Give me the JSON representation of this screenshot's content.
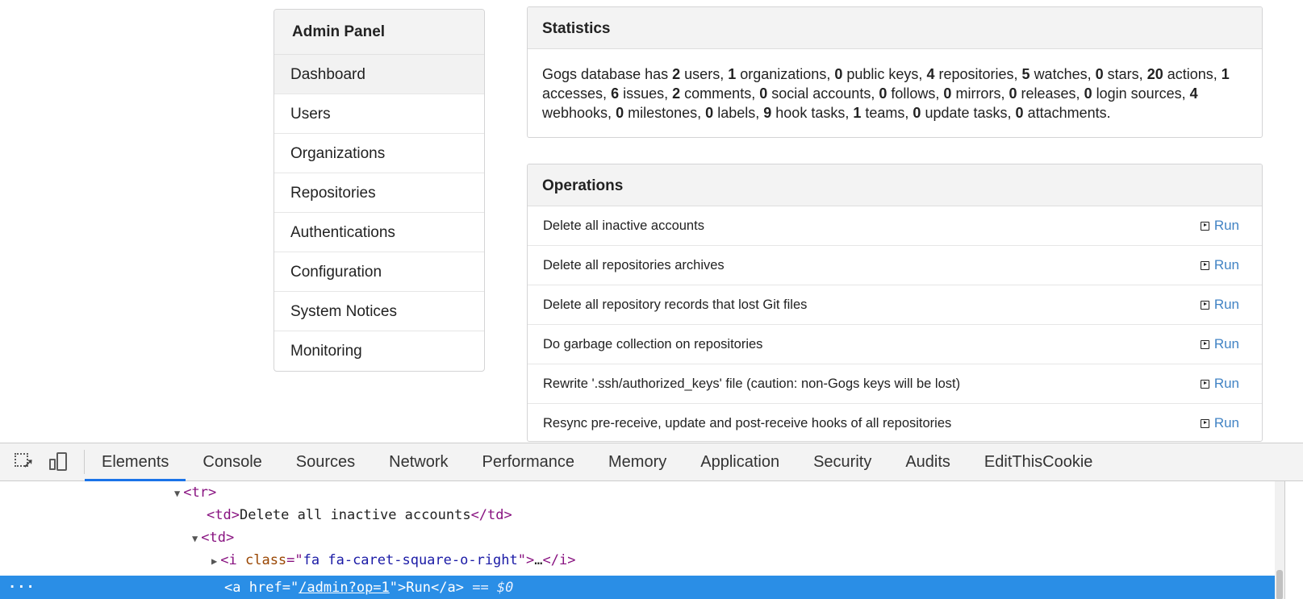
{
  "sidebar": {
    "title": "Admin Panel",
    "items": [
      {
        "label": "Dashboard"
      },
      {
        "label": "Users"
      },
      {
        "label": "Organizations"
      },
      {
        "label": "Repositories"
      },
      {
        "label": "Authentications"
      },
      {
        "label": "Configuration"
      },
      {
        "label": "System Notices"
      },
      {
        "label": "Monitoring"
      }
    ]
  },
  "statistics": {
    "title": "Statistics",
    "prefix": "Gogs database has",
    "entries": [
      {
        "count": "2",
        "label": "users,"
      },
      {
        "count": "1",
        "label": "organizations,"
      },
      {
        "count": "0",
        "label": "public keys,"
      },
      {
        "count": "4",
        "label": "repositories,"
      },
      {
        "count": "5",
        "label": "watches,"
      },
      {
        "count": "0",
        "label": "stars,"
      },
      {
        "count": "20",
        "label": "actions,"
      },
      {
        "count": "1",
        "label": "accesses,"
      },
      {
        "count": "6",
        "label": "issues,"
      },
      {
        "count": "2",
        "label": "comments,"
      },
      {
        "count": "0",
        "label": "social accounts,"
      },
      {
        "count": "0",
        "label": "follows,"
      },
      {
        "count": "0",
        "label": "mirrors,"
      },
      {
        "count": "0",
        "label": "releases,"
      },
      {
        "count": "0",
        "label": "login sources,"
      },
      {
        "count": "4",
        "label": "webhooks,"
      },
      {
        "count": "0",
        "label": "milestones,"
      },
      {
        "count": "0",
        "label": "labels,"
      },
      {
        "count": "9",
        "label": "hook tasks,"
      },
      {
        "count": "1",
        "label": "teams,"
      },
      {
        "count": "0",
        "label": "update tasks,"
      },
      {
        "count": "0",
        "label": "attachments."
      }
    ]
  },
  "operations": {
    "title": "Operations",
    "run_label": "Run",
    "rows": [
      {
        "label": "Delete all inactive accounts"
      },
      {
        "label": "Delete all repositories archives"
      },
      {
        "label": "Delete all repository records that lost Git files"
      },
      {
        "label": "Do garbage collection on repositories"
      },
      {
        "label": "Rewrite '.ssh/authorized_keys' file (caution: non-Gogs keys will be lost)"
      },
      {
        "label": "Resync pre-receive, update and post-receive hooks of all repositories"
      }
    ]
  },
  "devtools": {
    "tabs": [
      {
        "label": "Elements"
      },
      {
        "label": "Console"
      },
      {
        "label": "Sources"
      },
      {
        "label": "Network"
      },
      {
        "label": "Performance"
      },
      {
        "label": "Memory"
      },
      {
        "label": "Application"
      },
      {
        "label": "Security"
      },
      {
        "label": "Audits"
      },
      {
        "label": "EditThisCookie"
      }
    ],
    "code": {
      "tr_tag": "tr",
      "td_tag": "td",
      "td_text": "Delete all inactive accounts",
      "i_tag": "i",
      "i_attr": "class",
      "i_value": "fa fa-caret-square-o-right",
      "ellipsis": "…",
      "a_tag": "a",
      "a_attr": "href",
      "a_value": "/admin?op=1",
      "a_text": "Run",
      "selected_marker": "== $0",
      "dots": "..."
    }
  },
  "colors": {
    "link": "#4183c4",
    "selection": "#2a8ee6",
    "tab_active": "#1a73e8"
  }
}
